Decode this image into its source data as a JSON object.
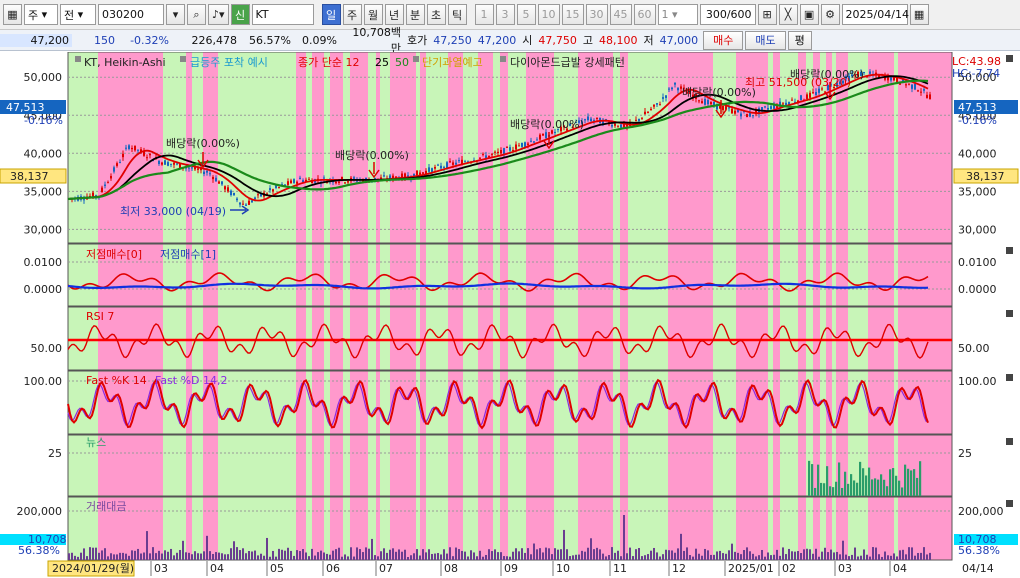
{
  "toolbar": {
    "market_select": "주",
    "type_select": "전",
    "code": "030200",
    "flag_icon": "신",
    "name": "KT",
    "periods": [
      "일",
      "주",
      "월",
      "년",
      "분",
      "초",
      "틱"
    ],
    "active_period": "일",
    "intervals": [
      "1",
      "3",
      "5",
      "10",
      "15",
      "30",
      "45",
      "60"
    ],
    "interval_select": "1",
    "count_value": "300",
    "count_total": "/600",
    "date": "2025/04/14"
  },
  "quote": {
    "price": "47,200",
    "change": "150",
    "change_pct": "-0.32%",
    "volume": "226,478",
    "vol_ratio": "56.57%",
    "turnover_pct": "0.09%",
    "amount": "10,708백만",
    "ask_label": "호가",
    "ask": "47,250",
    "bid": "47,200",
    "open_label": "시",
    "open": "47,750",
    "high_label": "고",
    "high": "48,100",
    "low_label": "저",
    "low": "47,000",
    "buy_label": "매수",
    "sell_label": "매도",
    "eval_label": "평"
  },
  "legend": {
    "main": [
      "KT, Heikin-Ashi",
      "급등주 포착 예시",
      "종가 단순 12",
      "25",
      "50",
      "단기과열예고",
      "다이아몬드급발 강세패턴"
    ],
    "lc": "LC:43.98",
    "hc": "HC:-7.74",
    "panel2": [
      "저점매수[0]",
      "저점매수[1]"
    ],
    "panel3": "RSI 7",
    "panel4": [
      "Fast %K 14",
      "Fast %D 14,2"
    ],
    "panel5": "뉴스",
    "panel6": "거래대금"
  },
  "annotations": {
    "div1": "배당락(0.00%)",
    "div2": "배당락(0.00%)",
    "div3": "배당락(0.00%)",
    "div4": "배당락(0.00%)",
    "div5": "배당락(0.00%)",
    "low": "최저 33,000 (04/19)",
    "high": "최고 51,500 (03/20)"
  },
  "axes": {
    "price_ticks": [
      "50,000",
      "45,000",
      "40,000",
      "35,000",
      "30,000"
    ],
    "current_price": "47,513",
    "current_pct": "-0.16%",
    "left_marker": "38,137",
    "right_marker": "38,137",
    "p2_ticks": [
      "0.0100",
      "0.0000"
    ],
    "p3_ticks": [
      "50.00"
    ],
    "p4_ticks": [
      "100.00"
    ],
    "p5_ticks": [
      "25"
    ],
    "p6_ticks": [
      "200,000"
    ],
    "p6_value": "10,708",
    "p6_pct": "56.38%",
    "dates": [
      "2024/01/29(월)",
      "03",
      "04",
      "05",
      "06",
      "07",
      "08",
      "09",
      "10",
      "11",
      "12",
      "2025/01",
      "02",
      "03",
      "04",
      "04/14"
    ]
  },
  "colors": {
    "pink": "#ff99cc",
    "green": "#c8f5b8",
    "ma12": "#e00000",
    "ma25": "#000000",
    "ma50": "#1a8a1a"
  }
}
